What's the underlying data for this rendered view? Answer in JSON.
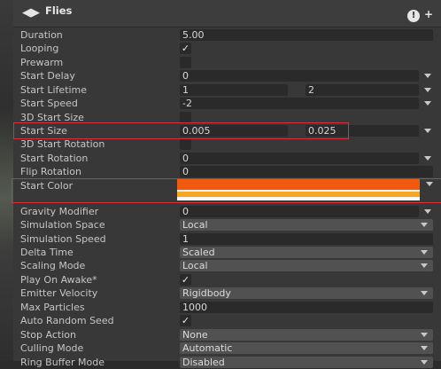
{
  "header": {
    "title": "Flies",
    "logo": "◀▶",
    "info": "!",
    "plus": "+"
  },
  "rows": [
    {
      "label": "Duration",
      "type": "field",
      "value": "5.00"
    },
    {
      "label": "Looping",
      "type": "check",
      "checked": true
    },
    {
      "label": "Prewarm",
      "type": "check",
      "checked": false
    },
    {
      "label": "Start Delay",
      "type": "field-caret",
      "value": "0"
    },
    {
      "label": "Start Lifetime",
      "type": "two-caret",
      "value1": "1",
      "value2": "2"
    },
    {
      "label": "Start Speed",
      "type": "field-caret",
      "value": "-2"
    },
    {
      "label": "3D Start Size",
      "type": "check",
      "checked": false
    },
    {
      "label": "Start Size",
      "type": "two-caret",
      "value1": "0.005",
      "value2": "0.025"
    },
    {
      "label": "3D Start Rotation",
      "type": "check",
      "checked": false
    },
    {
      "label": "Start Rotation",
      "type": "field-caret",
      "value": "0"
    },
    {
      "label": "Flip Rotation",
      "type": "field",
      "value": "0"
    },
    {
      "label": "Start Color",
      "type": "color"
    },
    {
      "label": "Gravity Modifier",
      "type": "field-caret",
      "value": "0"
    },
    {
      "label": "Simulation Space",
      "type": "dropdown",
      "value": "Local"
    },
    {
      "label": "Simulation Speed",
      "type": "field",
      "value": "1"
    },
    {
      "label": "Delta Time",
      "type": "dropdown",
      "value": "Scaled"
    },
    {
      "label": "Scaling Mode",
      "type": "dropdown",
      "value": "Local"
    },
    {
      "label": "Play On Awake*",
      "type": "check",
      "checked": true
    },
    {
      "label": "Emitter Velocity",
      "type": "dropdown",
      "value": "Rigidbody"
    },
    {
      "label": "Max Particles",
      "type": "field",
      "value": "1000"
    },
    {
      "label": "Auto Random Seed",
      "type": "check",
      "checked": true
    },
    {
      "label": "Stop Action",
      "type": "dropdown",
      "value": "None"
    },
    {
      "label": "Culling Mode",
      "type": "dropdown",
      "value": "Automatic"
    },
    {
      "label": "Ring Buffer Mode",
      "type": "dropdown",
      "value": "Disabled"
    }
  ],
  "colors": {
    "highlight": "#d8323c",
    "start_color": "#f15a0e"
  },
  "icons": {
    "checkmark": "✓"
  }
}
